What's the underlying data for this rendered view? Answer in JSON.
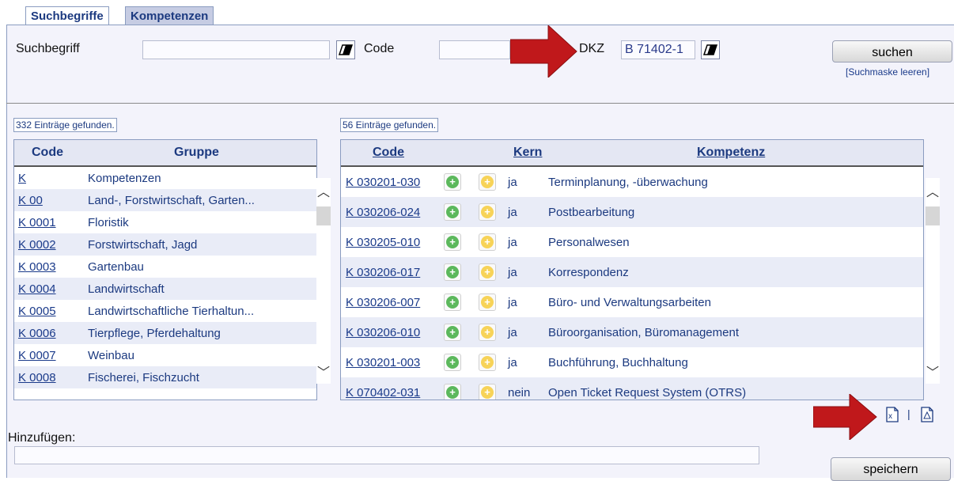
{
  "tabs": [
    {
      "label": "Suchbegriffe"
    },
    {
      "label": "Kompetenzen"
    }
  ],
  "search": {
    "suchbegriff_label": "Suchbegriff",
    "suchbegriff_value": "",
    "code_label": "Code",
    "code_value": "",
    "dkz_label": "DKZ",
    "dkz_value": "B 71402-1",
    "search_button": "suchen",
    "clear_link": "[Suchmaske leeren]"
  },
  "left_table": {
    "count": "332 Einträge gefunden.",
    "headers": [
      "Code",
      "Gruppe"
    ],
    "rows": [
      {
        "code": "K",
        "group": "Kompetenzen"
      },
      {
        "code": "K 00",
        "group": "Land-, Forstwirtschaft, Garten..."
      },
      {
        "code": "K 0001",
        "group": "Floristik"
      },
      {
        "code": "K 0002",
        "group": "Forstwirtschaft, Jagd"
      },
      {
        "code": "K 0003",
        "group": "Gartenbau"
      },
      {
        "code": "K 0004",
        "group": "Landwirtschaft"
      },
      {
        "code": "K 0005",
        "group": "Landwirtschaftliche Tierhaltun..."
      },
      {
        "code": "K 0006",
        "group": "Tierpflege, Pferdehaltung"
      },
      {
        "code": "K 0007",
        "group": "Weinbau"
      },
      {
        "code": "K 0008",
        "group": "Fischerei, Fischzucht"
      }
    ]
  },
  "right_table": {
    "count": "56 Einträge gefunden.",
    "headers": [
      "Code",
      "Kern",
      "Kompetenz"
    ],
    "rows": [
      {
        "code": "K 030201-030",
        "kern": "ja",
        "kompetenz": "Terminplanung, -überwachung"
      },
      {
        "code": "K 030206-024",
        "kern": "ja",
        "kompetenz": "Postbearbeitung"
      },
      {
        "code": "K 030205-010",
        "kern": "ja",
        "kompetenz": "Personalwesen"
      },
      {
        "code": "K 030206-017",
        "kern": "ja",
        "kompetenz": "Korrespondenz"
      },
      {
        "code": "K 030206-007",
        "kern": "ja",
        "kompetenz": "Büro- und Verwaltungsarbeiten"
      },
      {
        "code": "K 030206-010",
        "kern": "ja",
        "kompetenz": "Büroorganisation, Büromanagement"
      },
      {
        "code": "K 030201-003",
        "kern": "ja",
        "kompetenz": "Buchführung, Buchhaltung"
      },
      {
        "code": "K 070402-031",
        "kern": "nein",
        "kompetenz": "Open Ticket Request System (OTRS)"
      }
    ]
  },
  "export": {
    "separator": "|",
    "excel_icon": "excel-export-icon",
    "pdf_icon": "pdf-export-icon"
  },
  "add": {
    "label": "Hinzufügen:",
    "value": ""
  },
  "save_button": "speichern",
  "colors": {
    "accent": "#1c3a80",
    "arrow": "#c0181b",
    "row_alt": "#e9ecf7",
    "tab_active": "#c6cce3"
  }
}
